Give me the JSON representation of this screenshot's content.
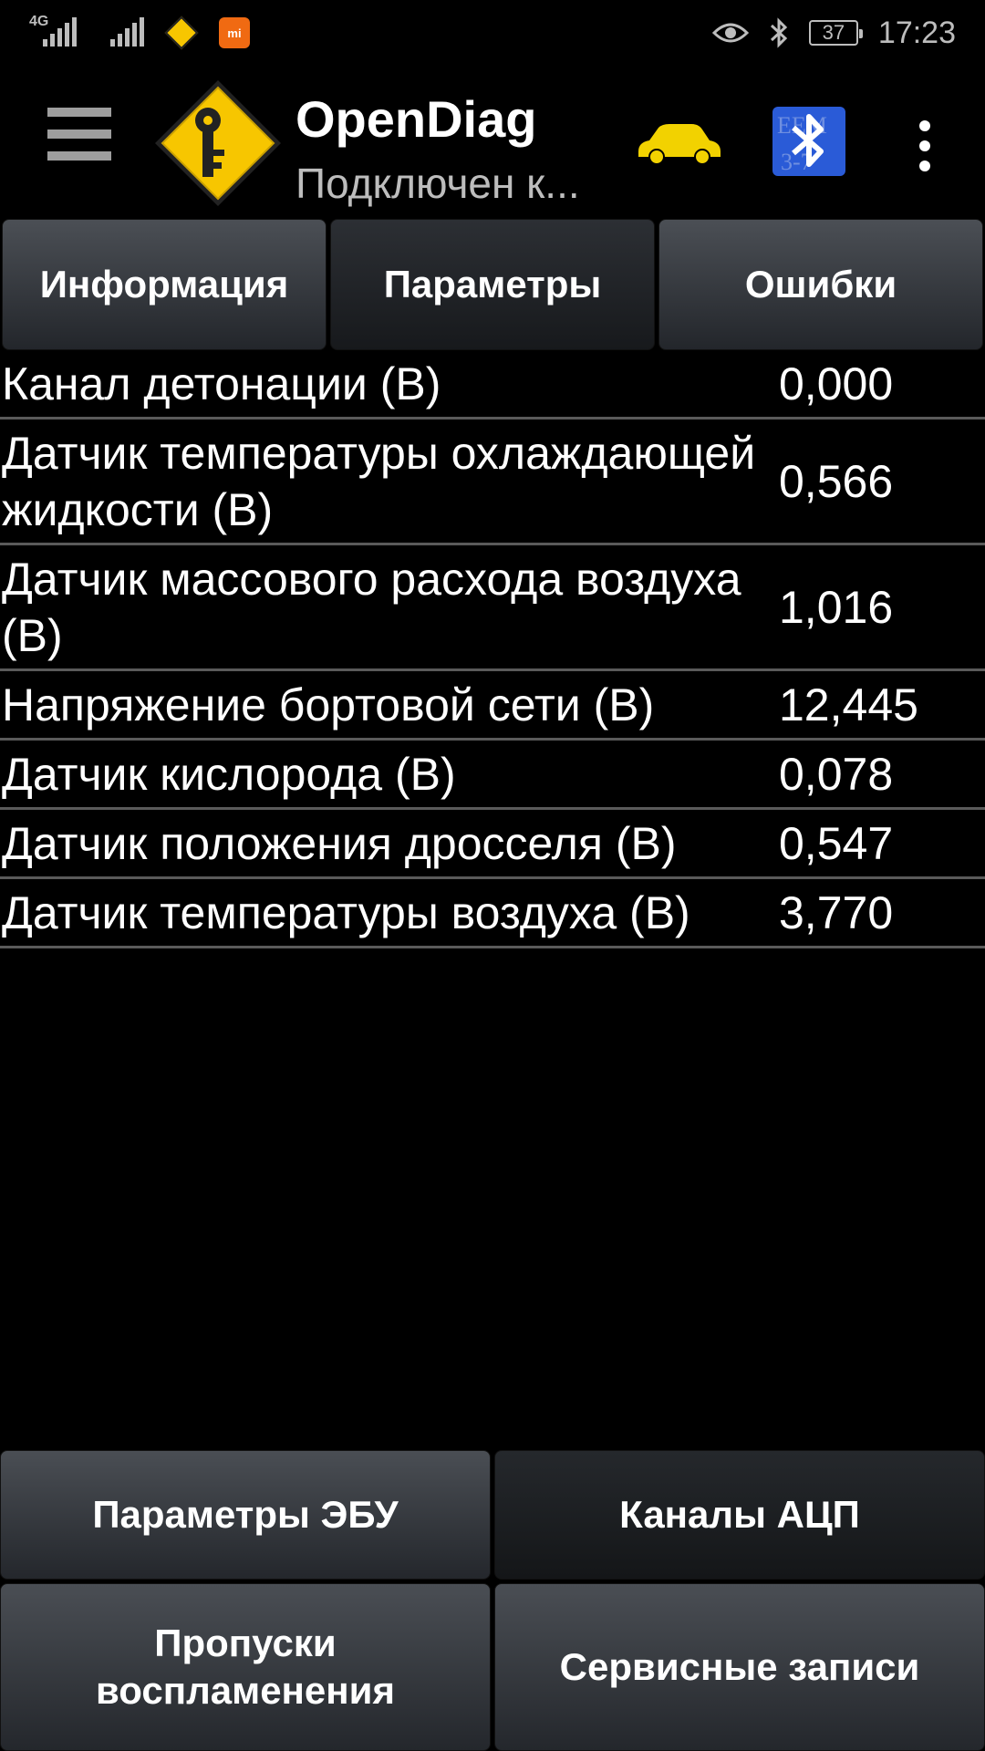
{
  "status_bar": {
    "network_tag": "4G",
    "mi_label": "mi",
    "battery": "37",
    "time": "17:23"
  },
  "app_bar": {
    "title": "OpenDiag",
    "subtitle": "Подключен к...",
    "ecu_badge_lines": [
      "ЕЕМ",
      "3-7"
    ]
  },
  "tabs": [
    {
      "label": "Информация"
    },
    {
      "label": "Параметры"
    },
    {
      "label": "Ошибки"
    }
  ],
  "parameters": [
    {
      "label": "Канал детонации (В)",
      "value": "0,000"
    },
    {
      "label": "Датчик температуры охлаждающей жидкости (В)",
      "value": "0,566"
    },
    {
      "label": "Датчик массового расхода воздуха (В)",
      "value": "1,016"
    },
    {
      "label": "Напряжение бортовой сети (В)",
      "value": "12,445"
    },
    {
      "label": "Датчик кислорода (В)",
      "value": "0,078"
    },
    {
      "label": "Датчик положения дросселя (В)",
      "value": "0,547"
    },
    {
      "label": "Датчик температуры воздуха (В)",
      "value": "3,770"
    }
  ],
  "bottom_buttons": [
    {
      "label": "Параметры ЭБУ"
    },
    {
      "label": "Каналы АЦП"
    },
    {
      "label": "Пропуски воспламенения"
    },
    {
      "label": "Сервисные записи"
    }
  ],
  "colors": {
    "background": "#000000",
    "accent_yellow": "#f7c600",
    "bluetooth_blue": "#2a5bd7",
    "divider": "#5a5a5a"
  }
}
